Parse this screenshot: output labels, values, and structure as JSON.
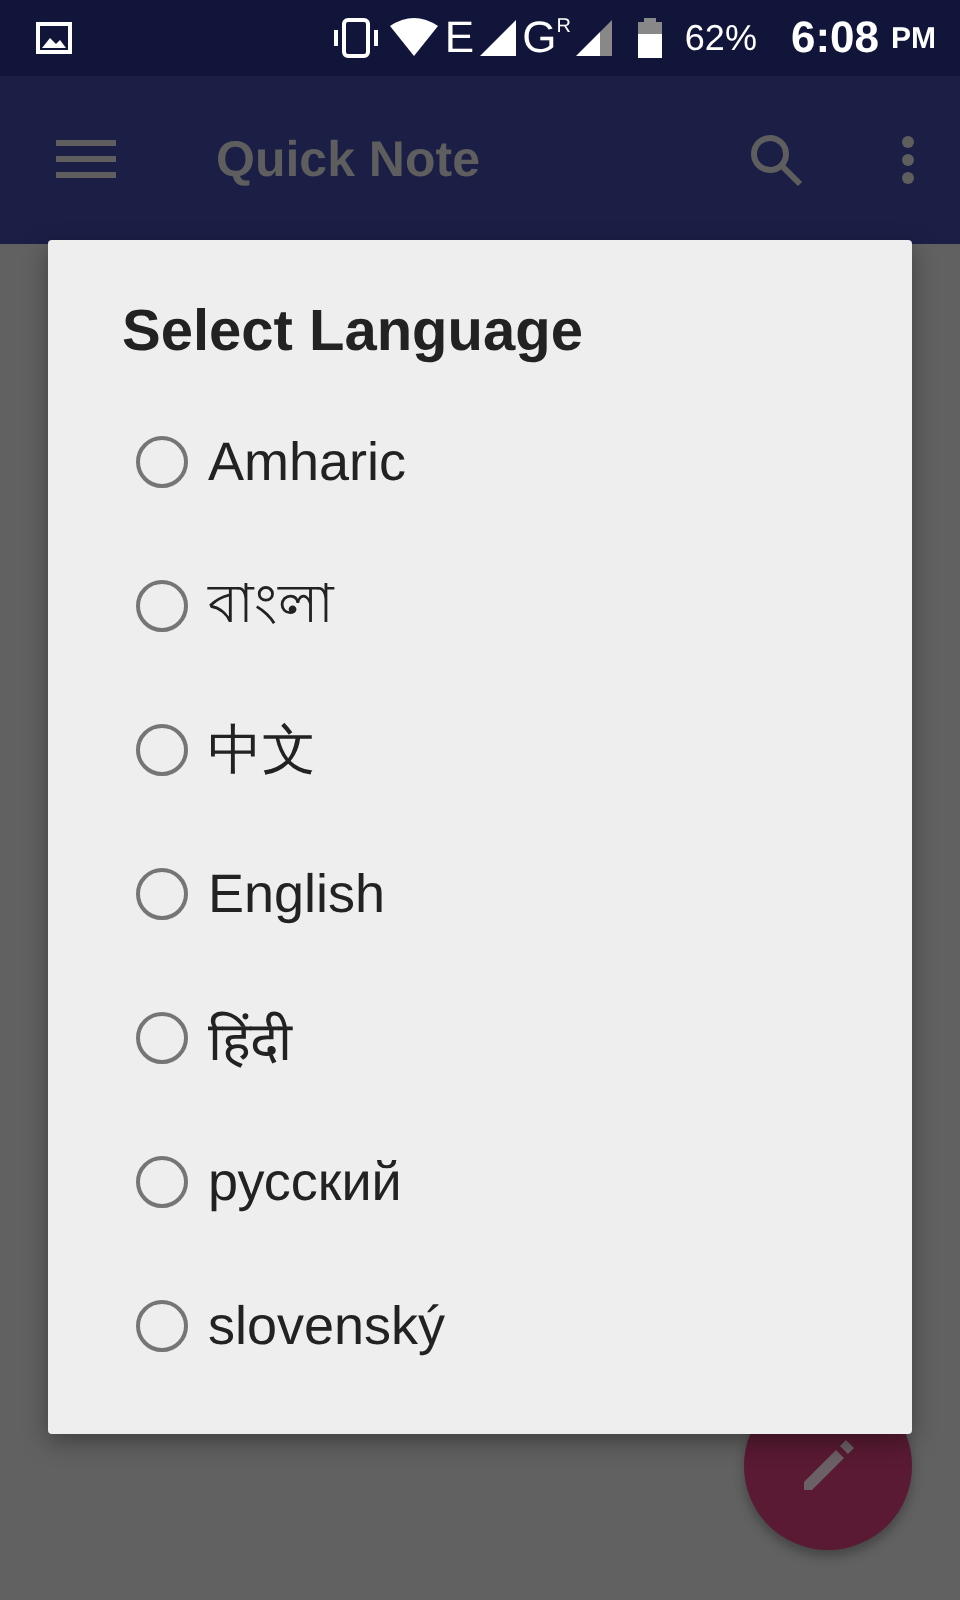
{
  "status_bar": {
    "network_1": "E",
    "network_2": "G",
    "roaming": "R",
    "battery": "62%",
    "time": "6:08",
    "ampm": "PM"
  },
  "app_bar": {
    "title": "Quick Note"
  },
  "dialog": {
    "title": "Select Language",
    "options": [
      {
        "label": "Amharic",
        "selected": false
      },
      {
        "label": "বাংলা",
        "selected": false
      },
      {
        "label": "中文",
        "selected": false
      },
      {
        "label": "English",
        "selected": false
      },
      {
        "label": "हिंदी",
        "selected": false
      },
      {
        "label": "русский",
        "selected": false
      },
      {
        "label": "slovenský",
        "selected": false
      }
    ]
  }
}
